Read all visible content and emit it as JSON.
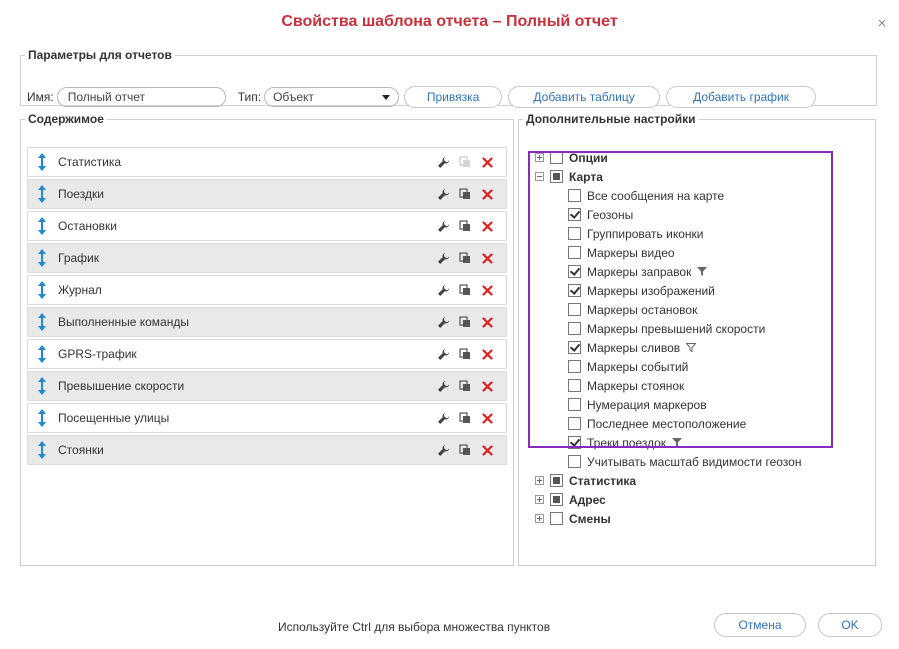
{
  "dialog": {
    "title": "Свойства шаблона отчета – Полный отчет"
  },
  "params": {
    "legend": "Параметры для отчетов",
    "name_label": "Имя:",
    "name_value": "Полный отчет",
    "type_label": "Тип:",
    "type_value": "Объект",
    "bind_label": "Привязка",
    "add_table_label": "Добавить таблицу",
    "add_chart_label": "Добавить график"
  },
  "content": {
    "legend": "Содержимое",
    "items": [
      {
        "label": "Статистика"
      },
      {
        "label": "Поездки"
      },
      {
        "label": "Остановки"
      },
      {
        "label": "График"
      },
      {
        "label": "Журнал"
      },
      {
        "label": "Выполненные команды"
      },
      {
        "label": "GPRS-трафик"
      },
      {
        "label": "Превышение скорости"
      },
      {
        "label": "Посещенные улицы"
      },
      {
        "label": "Стоянки"
      }
    ]
  },
  "extra": {
    "legend": "Дополнительные настройки",
    "nodes": [
      {
        "label": "Опции",
        "state": "unchecked",
        "expanded": false
      },
      {
        "label": "Карта",
        "state": "partial",
        "expanded": true
      },
      {
        "label": "Статистика",
        "state": "partial",
        "expanded": false
      },
      {
        "label": "Адрес",
        "state": "partial",
        "expanded": false
      },
      {
        "label": "Смены",
        "state": "unchecked",
        "expanded": false
      }
    ],
    "map_children": [
      {
        "label": "Все сообщения на карте",
        "checked": false
      },
      {
        "label": "Геозоны",
        "checked": true
      },
      {
        "label": "Группировать иконки",
        "checked": false
      },
      {
        "label": "Маркеры видео",
        "checked": false
      },
      {
        "label": "Маркеры заправок",
        "checked": true,
        "filter": "filled"
      },
      {
        "label": "Маркеры изображений",
        "checked": true
      },
      {
        "label": "Маркеры остановок",
        "checked": false
      },
      {
        "label": "Маркеры превышений скорости",
        "checked": false
      },
      {
        "label": "Маркеры сливов",
        "checked": true,
        "filter": "outline"
      },
      {
        "label": "Маркеры событий",
        "checked": false
      },
      {
        "label": "Маркеры стоянок",
        "checked": false
      },
      {
        "label": "Нумерация маркеров",
        "checked": false
      },
      {
        "label": "Последнее местоположение",
        "checked": false
      },
      {
        "label": "Треки поездок",
        "checked": true,
        "filter": "filled"
      },
      {
        "label": "Учитывать масштаб видимости геозон",
        "checked": false
      }
    ]
  },
  "footer": {
    "hint": "Используйте Ctrl для выбора множества пунктов",
    "cancel_label": "Отмена",
    "ok_label": "OK"
  },
  "colors": {
    "title": "#c9303b",
    "link": "#2f73b8",
    "drag_icon": "#1e88d6",
    "delete_icon": "#e02020",
    "highlight": "#8a2bc0"
  }
}
